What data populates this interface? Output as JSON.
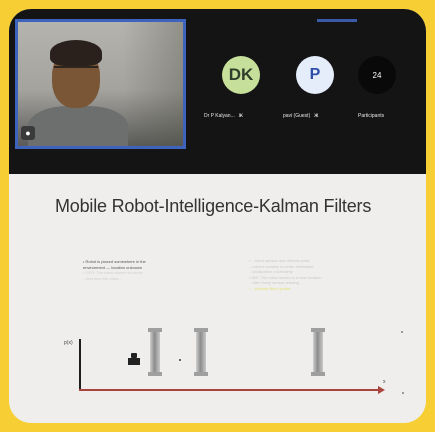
{
  "meeting": {
    "self_video": {
      "mic_icon": "mic-icon"
    },
    "participants": [
      {
        "initials": "DK",
        "name": "Dr P Kalyan...",
        "mic_icon": "mic-muted-icon",
        "avatar_color": "#c6df9a"
      },
      {
        "initials": "P",
        "name": "pavi (Guest)",
        "mic_icon": "mic-muted-icon",
        "avatar_color": "#e5edfb"
      }
    ],
    "participant_count": {
      "value": "24",
      "label": "Participants"
    }
  },
  "slide": {
    "title": "Mobile Robot-Intelligence-Kalman Filters",
    "left_bullets": [
      "•  Robot is placed somewhere in the",
      "    environment — location unknown",
      "•  GPS: The robot started to sense",
      "    ...first time the robot..."
    ],
    "right_bullets": [
      "•  ...robot senses and detects walls",
      "    ...robot's location is better estimated",
      "    ...localization uncertainty",
      "•  INS: The robot moves to a new location",
      "    ...after every sensor reading",
      "•  ...Kalman filter update"
    ],
    "diagram": {
      "y_label": "p(x)",
      "x_label": "x"
    }
  },
  "colors": {
    "frame": "#f7cf35",
    "self_view_border": "#3e63bd",
    "axis": "#a9443e"
  }
}
